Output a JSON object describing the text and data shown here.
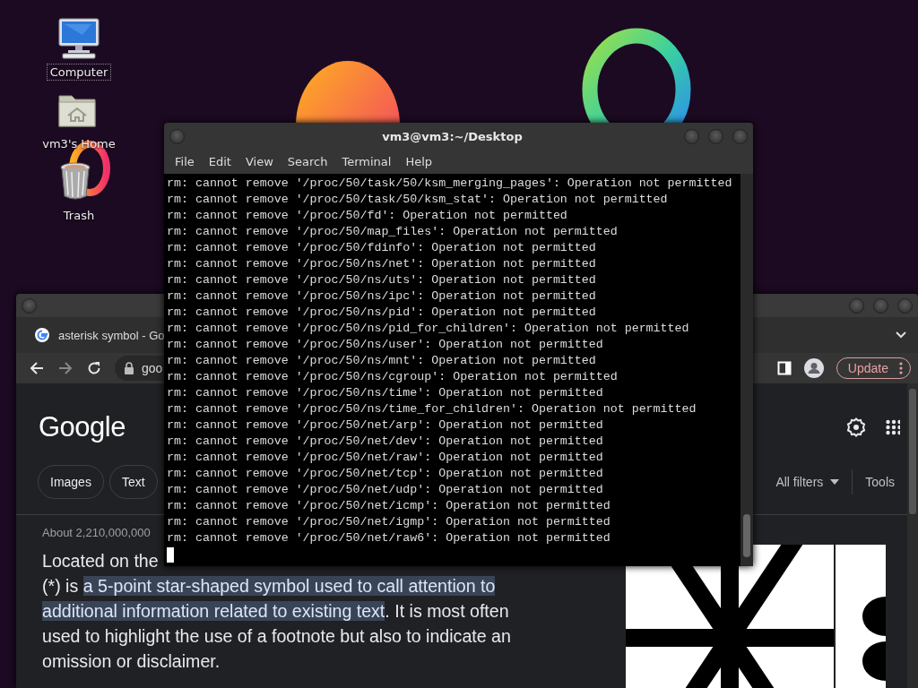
{
  "desktop_icons": [
    {
      "label": "Computer",
      "kind": "computer",
      "selected": true
    },
    {
      "label": "vm3's Home",
      "kind": "home",
      "selected": false
    },
    {
      "label": "Trash",
      "kind": "trash",
      "selected": false
    }
  ],
  "browser": {
    "tab_title": "asterisk symbol - Go",
    "address": "goo",
    "update_button": "Update",
    "logo": "Google",
    "chips": [
      "Images",
      "Text"
    ],
    "all_filters": "All filters",
    "tools": "Tools",
    "result_stats": "About 2,210,000,000",
    "snippet_first_line": "Located on the",
    "snippet": {
      "before": "(*) is ",
      "highlight": "a 5-point star-shaped symbol used to call attention to additional information related to existing text",
      "after": ". It is most often used to highlight the use of a footnote but also to indicate an omission or disclaimer."
    }
  },
  "terminal": {
    "title": "vm3@vm3:~/Desktop",
    "menu": [
      "File",
      "Edit",
      "View",
      "Search",
      "Terminal",
      "Help"
    ],
    "lines": [
      "rm: cannot remove '/proc/50/task/50/ksm_merging_pages': Operation not permitted",
      "rm: cannot remove '/proc/50/task/50/ksm_stat': Operation not permitted",
      "rm: cannot remove '/proc/50/fd': Operation not permitted",
      "rm: cannot remove '/proc/50/map_files': Operation not permitted",
      "rm: cannot remove '/proc/50/fdinfo': Operation not permitted",
      "rm: cannot remove '/proc/50/ns/net': Operation not permitted",
      "rm: cannot remove '/proc/50/ns/uts': Operation not permitted",
      "rm: cannot remove '/proc/50/ns/ipc': Operation not permitted",
      "rm: cannot remove '/proc/50/ns/pid': Operation not permitted",
      "rm: cannot remove '/proc/50/ns/pid_for_children': Operation not permitted",
      "rm: cannot remove '/proc/50/ns/user': Operation not permitted",
      "rm: cannot remove '/proc/50/ns/mnt': Operation not permitted",
      "rm: cannot remove '/proc/50/ns/cgroup': Operation not permitted",
      "rm: cannot remove '/proc/50/ns/time': Operation not permitted",
      "rm: cannot remove '/proc/50/ns/time_for_children': Operation not permitted",
      "rm: cannot remove '/proc/50/net/arp': Operation not permitted",
      "rm: cannot remove '/proc/50/net/dev': Operation not permitted",
      "rm: cannot remove '/proc/50/net/raw': Operation not permitted",
      "rm: cannot remove '/proc/50/net/tcp': Operation not permitted",
      "rm: cannot remove '/proc/50/net/udp': Operation not permitted",
      "rm: cannot remove '/proc/50/net/icmp': Operation not permitted",
      "rm: cannot remove '/proc/50/net/igmp': Operation not permitted",
      "rm: cannot remove '/proc/50/net/raw6': Operation not permitted"
    ]
  }
}
